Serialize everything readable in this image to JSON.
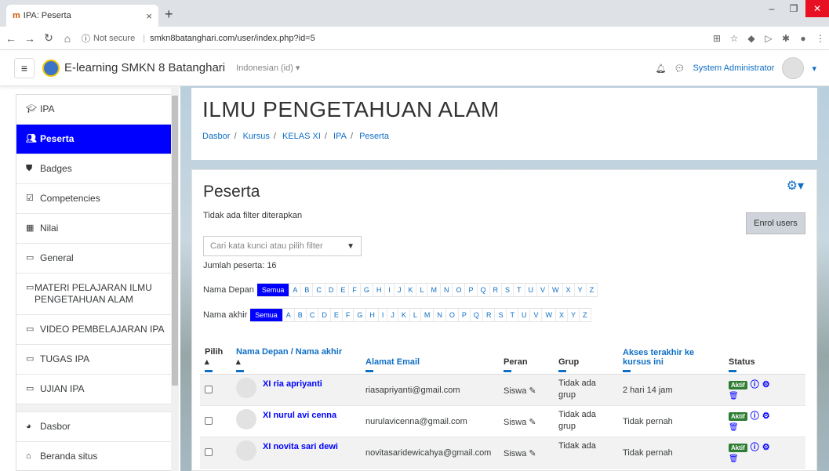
{
  "browser": {
    "tab_icon": "moodle-favicon",
    "tab_title": "IPA: Peserta",
    "tab_close": "×",
    "new_tab": "+",
    "url_security": "Not secure",
    "url": "smkn8batanghari.com/user/index.php?id=5"
  },
  "navbar": {
    "site_name": "E-learning SMKN 8 Batanghari",
    "language": "Indonesian (id) ▾",
    "user_name": "System Administrator"
  },
  "drawer": {
    "items": [
      {
        "label": "IPA",
        "icon": "graduation-cap-icon"
      },
      {
        "label": "Peserta",
        "icon": "users-icon"
      },
      {
        "label": "Badges",
        "icon": "shield-icon"
      },
      {
        "label": "Competencies",
        "icon": "check-square-icon"
      },
      {
        "label": "Nilai",
        "icon": "table-icon"
      },
      {
        "label": "General",
        "icon": "folder-icon"
      },
      {
        "label": "MATERI PELAJARAN ILMU PENGETAHUAN ALAM",
        "icon": "folder-icon"
      },
      {
        "label": "VIDEO PEMBELAJARAN IPA",
        "icon": "folder-icon"
      },
      {
        "label": "TUGAS IPA",
        "icon": "folder-icon"
      },
      {
        "label": "UJIAN IPA",
        "icon": "folder-icon"
      },
      {
        "label": "Dasbor",
        "icon": "dashboard-icon"
      },
      {
        "label": "Beranda situs",
        "icon": "home-icon"
      }
    ]
  },
  "header": {
    "title": "ILMU PENGETAHUAN ALAM",
    "breadcrumb": [
      "Dasbor",
      "Kursus",
      "KELAS XI",
      "IPA",
      "Peserta"
    ]
  },
  "main": {
    "heading": "Peserta",
    "no_filter": "Tidak ada filter diterapkan",
    "enrol_button": "Enrol users",
    "filter_placeholder": "Cari kata kunci atau pilih filter",
    "count": "Jumlah peserta: 16",
    "first_name_label": "Nama Depan",
    "last_name_label": "Nama akhir",
    "all_label": "Semua",
    "letters": [
      "A",
      "B",
      "C",
      "D",
      "E",
      "F",
      "G",
      "H",
      "I",
      "J",
      "K",
      "L",
      "M",
      "N",
      "O",
      "P",
      "Q",
      "R",
      "S",
      "T",
      "U",
      "V",
      "W",
      "X",
      "Y",
      "Z"
    ]
  },
  "table": {
    "headers": {
      "select": "Pilih",
      "name": "Nama Depan / Nama akhir",
      "email": "Alamat Email",
      "role": "Peran",
      "group": "Grup",
      "last_access": "Akses terakhir ke kursus ini",
      "status": "Status"
    },
    "rows": [
      {
        "name": "XI ria apriyanti",
        "email": "riasapriyanti@gmail.com",
        "role": "Siswa",
        "group": "Tidak ada grup",
        "last_access": "2 hari 14 jam",
        "status": "Aktif"
      },
      {
        "name": "XI nurul avi cenna",
        "email": "nurulavicenna@gmail.com",
        "role": "Siswa",
        "group": "Tidak ada grup",
        "last_access": "Tidak pernah",
        "status": "Aktif"
      },
      {
        "name": "XI novita sari dewi",
        "email": "novitasaridewicahya@gmail.com",
        "role": "Siswa",
        "group": "Tidak ada",
        "last_access": "Tidak pernah",
        "status": "Aktif"
      }
    ]
  }
}
